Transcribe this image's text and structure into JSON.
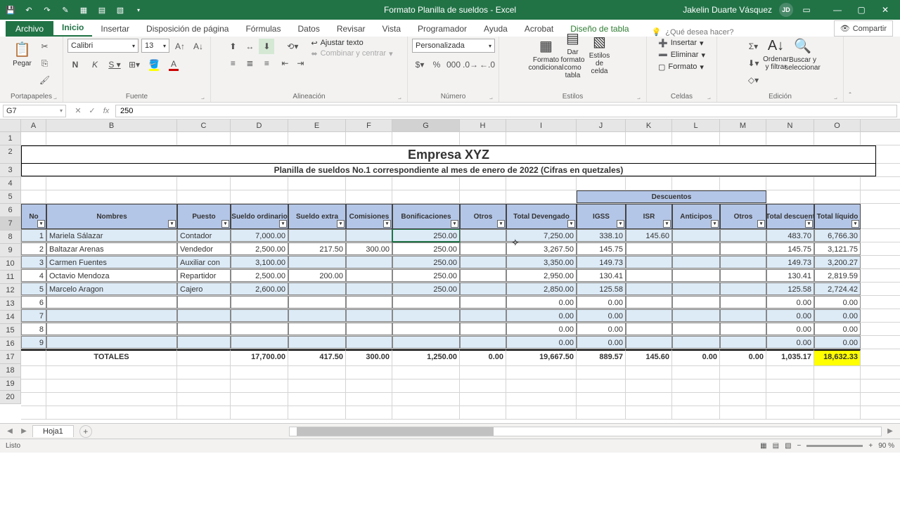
{
  "app": {
    "title": "Formato Planilla de sueldos  -  Excel",
    "user_name": "Jakelin Duarte Vásquez",
    "user_initials": "JD"
  },
  "tabs": {
    "file": "Archivo",
    "home": "Inicio",
    "insert": "Insertar",
    "layout": "Disposición de página",
    "formulas": "Fórmulas",
    "data": "Datos",
    "review": "Revisar",
    "view": "Vista",
    "developer": "Programador",
    "help": "Ayuda",
    "acrobat": "Acrobat",
    "design": "Diseño de tabla",
    "tellme": "¿Qué desea hacer?",
    "share": "Compartir"
  },
  "ribbon": {
    "clipboard": {
      "label": "Portapapeles",
      "paste": "Pegar"
    },
    "font": {
      "label": "Fuente",
      "name": "Calibri",
      "size": "13"
    },
    "align": {
      "label": "Alineación",
      "wrap": "Ajustar texto",
      "merge": "Combinar y centrar"
    },
    "number": {
      "label": "Número",
      "format": "Personalizada"
    },
    "styles": {
      "label": "Estilos",
      "cond": "Formato condicional",
      "table": "Dar formato como tabla",
      "cell": "Estilos de celda"
    },
    "cells": {
      "label": "Celdas",
      "insert": "Insertar",
      "delete": "Eliminar",
      "format": "Formato"
    },
    "editing": {
      "label": "Edición",
      "sort": "Ordenar y filtrar",
      "find": "Buscar y seleccionar"
    }
  },
  "formula": {
    "cell_ref": "G7",
    "value": "250"
  },
  "sheet": {
    "columns": [
      "A",
      "B",
      "C",
      "D",
      "E",
      "F",
      "G",
      "H",
      "I",
      "J",
      "K",
      "L",
      "M",
      "N",
      "O"
    ],
    "title": "Empresa XYZ",
    "subtitle": "Planilla de sueldos No.1 correspondiente al mes de enero de 2022 (Cifras en quetzales)",
    "desc_group": "Descuentos",
    "headers": {
      "no": "No",
      "nombres": "Nombres",
      "puesto": "Puesto",
      "sueldo_ord": "Sueldo ordinario",
      "sueldo_ext": "Sueldo extra",
      "comis": "Comisiones",
      "bonif": "Bonificaciones",
      "otros": "Otros",
      "tot_dev": "Total Devengado",
      "igss": "IGSS",
      "isr": "ISR",
      "antic": "Anticipos",
      "otros2": "Otros",
      "tot_desc": "Total descuent",
      "tot_liq": "Total líquido"
    },
    "rows": [
      {
        "n": "1",
        "nom": "Mariela Sálazar",
        "puesto": "Contador",
        "so": "7,000.00",
        "se": "",
        "com": "",
        "bon": "250.00",
        "ot": "",
        "td": "7,250.00",
        "igss": "338.10",
        "isr": "145.60",
        "ant": "",
        "ot2": "",
        "tdesc": "483.70",
        "tliq": "6,766.30"
      },
      {
        "n": "2",
        "nom": "Baltazar Arenas",
        "puesto": "Vendedor",
        "so": "2,500.00",
        "se": "217.50",
        "com": "300.00",
        "bon": "250.00",
        "ot": "",
        "td": "3,267.50",
        "igss": "145.75",
        "isr": "",
        "ant": "",
        "ot2": "",
        "tdesc": "145.75",
        "tliq": "3,121.75"
      },
      {
        "n": "3",
        "nom": "Carmen Fuentes",
        "puesto": "Auxiliar con",
        "so": "3,100.00",
        "se": "",
        "com": "",
        "bon": "250.00",
        "ot": "",
        "td": "3,350.00",
        "igss": "149.73",
        "isr": "",
        "ant": "",
        "ot2": "",
        "tdesc": "149.73",
        "tliq": "3,200.27"
      },
      {
        "n": "4",
        "nom": "Octavio Mendoza",
        "puesto": "Repartidor",
        "so": "2,500.00",
        "se": "200.00",
        "com": "",
        "bon": "250.00",
        "ot": "",
        "td": "2,950.00",
        "igss": "130.41",
        "isr": "",
        "ant": "",
        "ot2": "",
        "tdesc": "130.41",
        "tliq": "2,819.59"
      },
      {
        "n": "5",
        "nom": "Marcelo Aragon",
        "puesto": "Cajero",
        "so": "2,600.00",
        "se": "",
        "com": "",
        "bon": "250.00",
        "ot": "",
        "td": "2,850.00",
        "igss": "125.58",
        "isr": "",
        "ant": "",
        "ot2": "",
        "tdesc": "125.58",
        "tliq": "2,724.42"
      },
      {
        "n": "6",
        "nom": "",
        "puesto": "",
        "so": "",
        "se": "",
        "com": "",
        "bon": "",
        "ot": "",
        "td": "0.00",
        "igss": "0.00",
        "isr": "",
        "ant": "",
        "ot2": "",
        "tdesc": "0.00",
        "tliq": "0.00"
      },
      {
        "n": "7",
        "nom": "",
        "puesto": "",
        "so": "",
        "se": "",
        "com": "",
        "bon": "",
        "ot": "",
        "td": "0.00",
        "igss": "0.00",
        "isr": "",
        "ant": "",
        "ot2": "",
        "tdesc": "0.00",
        "tliq": "0.00"
      },
      {
        "n": "8",
        "nom": "",
        "puesto": "",
        "so": "",
        "se": "",
        "com": "",
        "bon": "",
        "ot": "",
        "td": "0.00",
        "igss": "0.00",
        "isr": "",
        "ant": "",
        "ot2": "",
        "tdesc": "0.00",
        "tliq": "0.00"
      },
      {
        "n": "9",
        "nom": "",
        "puesto": "",
        "so": "",
        "se": "",
        "com": "",
        "bon": "",
        "ot": "",
        "td": "0.00",
        "igss": "0.00",
        "isr": "",
        "ant": "",
        "ot2": "",
        "tdesc": "0.00",
        "tliq": "0.00"
      }
    ],
    "totals": {
      "label": "TOTALES",
      "so": "17,700.00",
      "se": "417.50",
      "com": "300.00",
      "bon": "1,250.00",
      "ot": "0.00",
      "td": "19,667.50",
      "igss": "889.57",
      "isr": "145.60",
      "ant": "0.00",
      "ot2": "0.00",
      "tdesc": "1,035.17",
      "tliq": "18,632.33"
    }
  },
  "status": {
    "ready": "Listo",
    "zoom": "90 %",
    "sheet": "Hoja1"
  }
}
